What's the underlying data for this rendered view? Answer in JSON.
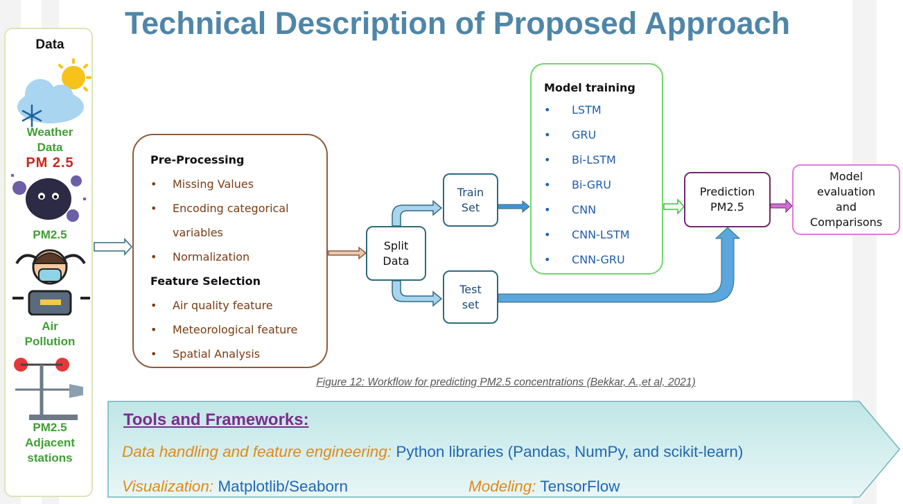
{
  "title": "Technical Description of Proposed Approach",
  "data_column": {
    "header": "Data",
    "weather_label": "Weather\nData",
    "pm_logo": "PM 2.5",
    "pm_label": "PM2.5",
    "air_label": "Air\nPollution",
    "adjacent_label": "PM2.5\nAdjacent\nstations"
  },
  "preprocessing": {
    "title": "Pre-Processing",
    "items": [
      "Missing Values",
      "Encoding categorical",
      "variables",
      "Normalization"
    ],
    "feature_title": "Feature Selection",
    "feature_items": [
      "Air quality feature",
      "Meteorological feature",
      "Spatial Analysis"
    ]
  },
  "split": {
    "label": "Split\nData"
  },
  "train": {
    "label": "Train\nSet"
  },
  "test": {
    "label": "Test\nset"
  },
  "model_training": {
    "title": "Model training",
    "items": [
      "LSTM",
      "GRU",
      "Bi-LSTM",
      "Bi-GRU",
      "CNN",
      "CNN-LSTM",
      "CNN-GRU"
    ]
  },
  "prediction": {
    "label": "Prediction\nPM2.5"
  },
  "evaluation": {
    "label": "Model\nevaluation\nand\nComparisons"
  },
  "caption": "Figure 12:  Workflow for predicting PM2.5 concentrations  (Bekkar, A.,et al, 2021)",
  "tools": {
    "title": "Tools and Frameworks:",
    "lines": [
      {
        "key": "Data handling and feature engineering:",
        "value": "Python libraries (Pandas, NumPy, and scikit-learn)"
      },
      {
        "key": "Visualization:",
        "value": "Matplotlib/Seaborn"
      },
      {
        "key": "Modeling:",
        "value": "TensorFlow"
      }
    ]
  },
  "colors": {
    "title": "#4f86a8",
    "preprocessing_border": "#8e5a3c",
    "model_border": "#6fd86a",
    "data_box_border": "#2f6a7d",
    "prediction_border": "#6b2a6e",
    "evaluation_border": "#e07bd8",
    "arrow_fill": "#5aa6dd",
    "tools_bg": "#d3eeee"
  }
}
